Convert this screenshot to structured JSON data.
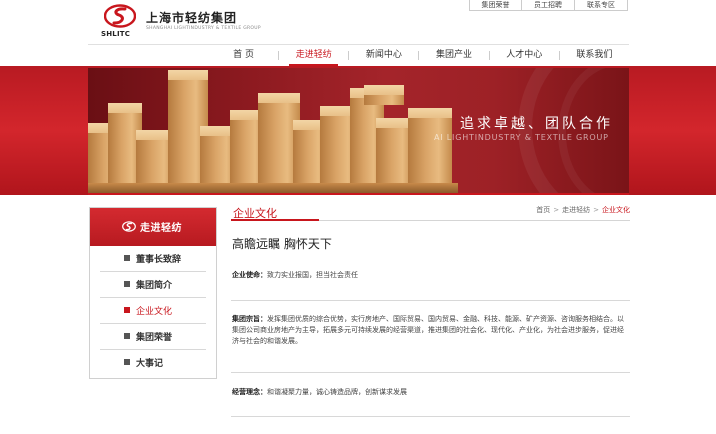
{
  "brand": {
    "name_cn": "上海市轻纺集团",
    "name_en": "SHANGHAI LIGHTINDUSTRY & TEXTILE GROUP",
    "abbr": "SHLITC",
    "color": "#c8161d"
  },
  "top_links": [
    "集团荣誉",
    "员工招聘",
    "联系专区"
  ],
  "nav": {
    "items": [
      "首 页",
      "走进轻纺",
      "新闻中心",
      "集团产业",
      "人才中心",
      "联系我们"
    ],
    "active_index": 1
  },
  "banner": {
    "slogan": "追求卓越、团队合作",
    "subtitle": "AI LIGHTINDUSTRY & TEXTILE GROUP"
  },
  "sidebar": {
    "title": "走进轻纺",
    "items": [
      "董事长致辞",
      "集团简介",
      "企业文化",
      "集团荣誉",
      "大事记"
    ],
    "active_index": 2
  },
  "main": {
    "section_title": "企业文化",
    "breadcrumb": [
      "首页",
      "走进轻纺",
      "企业文化"
    ],
    "headline": "高瞻远瞩 胸怀天下",
    "paragraphs": [
      {
        "label": "企业使命：",
        "text": "致力实业报国，担当社会责任"
      },
      {
        "label": "集团宗旨：",
        "text": "发挥集团优质的综合优势，实行房地产、国际贸易、国内贸易、金融、科技、能源、矿产资源、咨询服务相结合。以集团公司商业房地产为主导，拓展多元可持续发展的经营渠道，推进集团的社会化、现代化、产业化，为社会进步服务，促进经济与社会的和谐发展。"
      },
      {
        "label": "经营理念：",
        "text": "和谐凝聚力量，诚心铸造品牌，创新谋求发展"
      }
    ]
  }
}
